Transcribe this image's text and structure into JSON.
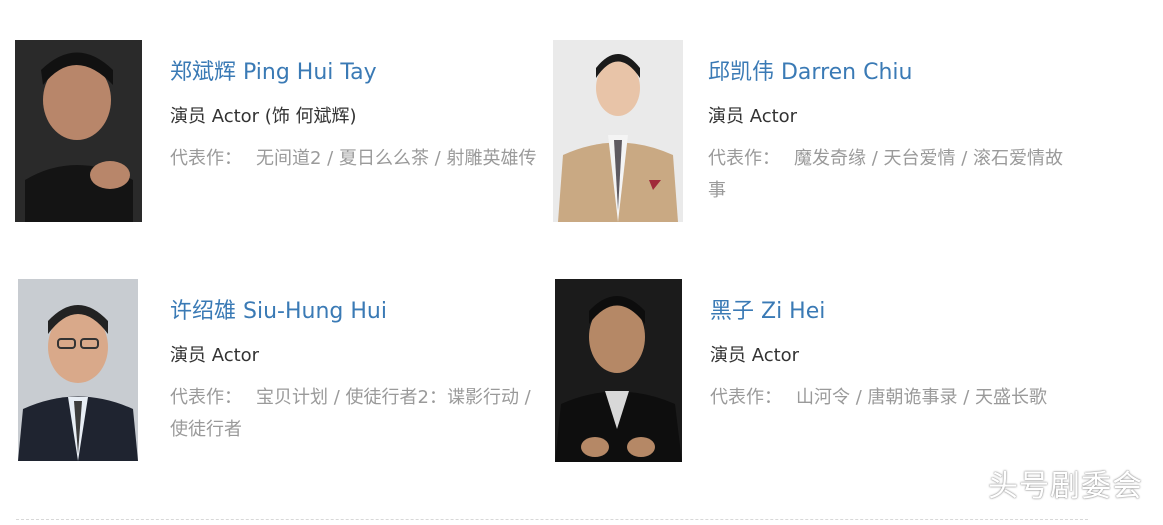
{
  "cast": [
    {
      "name": "郑斌辉 Ping Hui Tay",
      "role": "演员 Actor (饰 何斌辉)",
      "works_label": "代表作：",
      "works": "无间道2 / 夏日么么茶 / 射雕英雄传"
    },
    {
      "name": "邱凯伟 Darren Chiu",
      "role": "演员 Actor",
      "works_label": "代表作：",
      "works": "魔发奇缘 / 天台爱情 / 滚石爱情故事"
    },
    {
      "name": "许绍雄 Siu-Hung Hui",
      "role": "演员 Actor",
      "works_label": "代表作：",
      "works": "宝贝计划 / 使徒行者2：谍影行动 / 使徒行者"
    },
    {
      "name": "黑子 Zi Hei",
      "role": "演员 Actor",
      "works_label": "代表作：",
      "works": "山河令 / 唐朝诡事录 / 天盛长歌"
    }
  ],
  "watermark": "头号剧委会",
  "colors": {
    "name_link": "#3a7ab5",
    "role_text": "#333333",
    "works_text": "#9a9a9a"
  }
}
